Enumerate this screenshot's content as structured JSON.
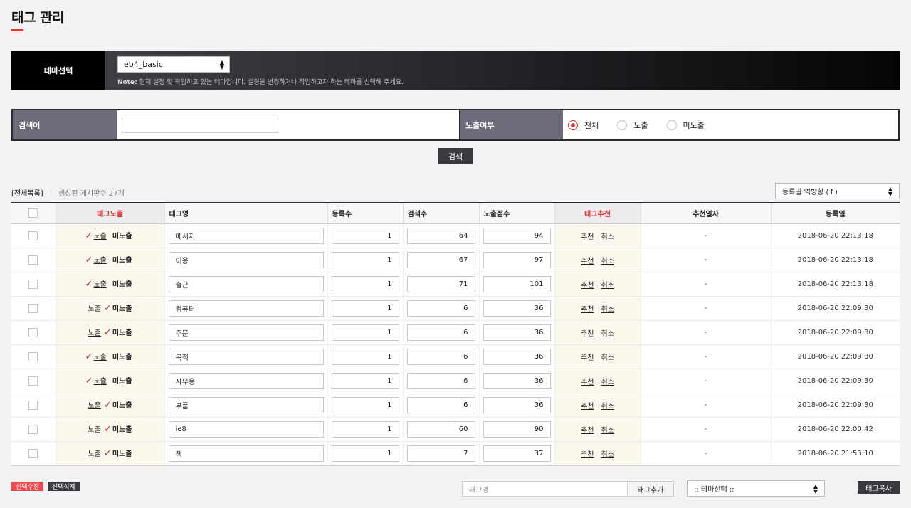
{
  "page": {
    "title": "태그 관리"
  },
  "theme": {
    "label": "테마선택",
    "selected": "eb4_basic",
    "note_prefix": "Note:",
    "note_text": " 현재 설정 및 작업하고 있는 테마입니다. 설정을 변경하거나 작업하고자 하는 테마를 선택해 주세요."
  },
  "search": {
    "keyword_label": "검색어",
    "keyword_value": "",
    "expose_label": "노출여부",
    "radio_all": "전체",
    "radio_show": "노출",
    "radio_hide": "미노출",
    "selected": "전체",
    "button": "검색"
  },
  "list": {
    "all_label": "[전체목록]",
    "count_text": "생성된 게시판수 27개",
    "sort": "등록일 역방향 (↑)"
  },
  "table": {
    "headers": {
      "expose": "태그노출",
      "name": "태그명",
      "reg_count": "등록수",
      "search_count": "검색수",
      "score": "노출점수",
      "recommend": "태그추천",
      "recommend_date": "추천일자",
      "reg_date": "등록일"
    },
    "show_label": "노출",
    "hide_label": "미노출",
    "recommend_label": "추천",
    "cancel_label": "취소",
    "rows": [
      {
        "exposed": true,
        "name": "메시지",
        "reg": "1",
        "search": "64",
        "score": "94",
        "reco_date": "-",
        "date": "2018-06-20 22:13:18"
      },
      {
        "exposed": true,
        "name": "이용",
        "reg": "1",
        "search": "67",
        "score": "97",
        "reco_date": "-",
        "date": "2018-06-20 22:13:18"
      },
      {
        "exposed": true,
        "name": "출근",
        "reg": "1",
        "search": "71",
        "score": "101",
        "reco_date": "-",
        "date": "2018-06-20 22:13:18"
      },
      {
        "exposed": false,
        "name": "컴퓨터",
        "reg": "1",
        "search": "6",
        "score": "36",
        "reco_date": "-",
        "date": "2018-06-20 22:09:30"
      },
      {
        "exposed": false,
        "name": "주문",
        "reg": "1",
        "search": "6",
        "score": "36",
        "reco_date": "-",
        "date": "2018-06-20 22:09:30"
      },
      {
        "exposed": true,
        "name": "목적",
        "reg": "1",
        "search": "6",
        "score": "36",
        "reco_date": "-",
        "date": "2018-06-20 22:09:30"
      },
      {
        "exposed": true,
        "name": "사무용",
        "reg": "1",
        "search": "6",
        "score": "36",
        "reco_date": "-",
        "date": "2018-06-20 22:09:30"
      },
      {
        "exposed": false,
        "name": "부품",
        "reg": "1",
        "search": "6",
        "score": "36",
        "reco_date": "-",
        "date": "2018-06-20 22:09:30"
      },
      {
        "exposed": false,
        "name": "ie8",
        "reg": "1",
        "search": "60",
        "score": "90",
        "reco_date": "-",
        "date": "2018-06-20 22:00:42"
      },
      {
        "exposed": false,
        "name": "책",
        "reg": "1",
        "search": "7",
        "score": "37",
        "reco_date": "-",
        "date": "2018-06-20 21:53:10"
      }
    ]
  },
  "bottom": {
    "edit_selected": "선택수정",
    "delete_selected": "선택삭제",
    "tag_placeholder": "태그명",
    "tag_add": "태그추가",
    "theme_pick": ":: 테마선택 ::",
    "tag_copy": "태그복사"
  },
  "colors": {
    "accent": "#e02020",
    "dark": "#3a3a3f",
    "label_bg": "#6d6c78"
  },
  "icons": {
    "check": "check-icon",
    "updown": "updown-arrow-icon"
  }
}
